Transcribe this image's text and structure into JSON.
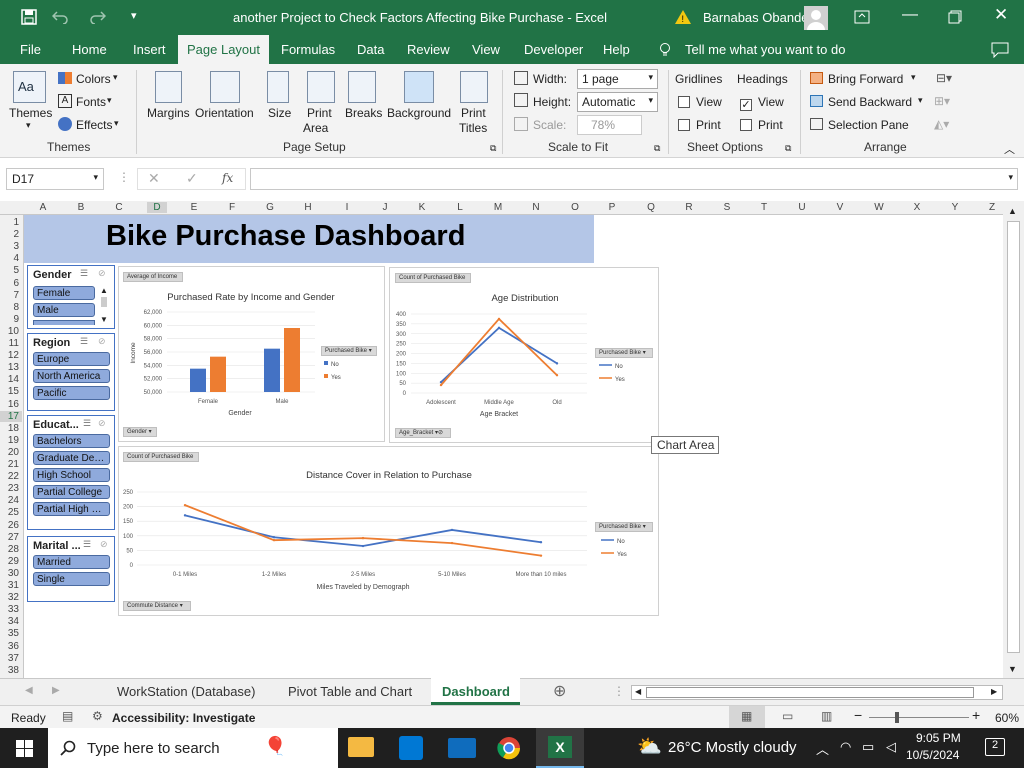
{
  "window": {
    "title": "another Project to Check Factors Affecting Bike Purchase  -  Excel",
    "user": "Barnabas Obande"
  },
  "menu": [
    "File",
    "Home",
    "Insert",
    "Page Layout",
    "Formulas",
    "Data",
    "Review",
    "View",
    "Developer",
    "Help"
  ],
  "tell_me": "Tell me what you want to do",
  "ribbon": {
    "themes": "Themes",
    "colors": "Colors",
    "fonts": "Fonts",
    "effects": "Effects",
    "margins": "Margins",
    "orientation": "Orientation",
    "size": "Size",
    "print_area": [
      "Print",
      "Area"
    ],
    "breaks": "Breaks",
    "background": "Background",
    "print_titles": [
      "Print",
      "Titles"
    ],
    "width_label": "Width:",
    "width_value": "1 page",
    "height_label": "Height:",
    "height_value": "Automatic",
    "scale_label": "Scale:",
    "scale_value": "78%",
    "gridlines": "Gridlines",
    "headings": "Headings",
    "view": "View",
    "print": "Print",
    "gridlines_view_checked": false,
    "headings_view_checked": true,
    "bring_forward": "Bring Forward",
    "send_backward": "Send Backward",
    "selection_pane": "Selection Pane",
    "groups": [
      "Themes",
      "Page Setup",
      "Scale to Fit",
      "Sheet Options",
      "Arrange"
    ]
  },
  "formula_bar": {
    "name_box": "D17",
    "fx": "fx",
    "formula": ""
  },
  "columns": [
    "A",
    "B",
    "C",
    "D",
    "E",
    "F",
    "G",
    "H",
    "I",
    "J",
    "K",
    "L",
    "M",
    "N",
    "O",
    "P",
    "Q",
    "R",
    "S",
    "T",
    "U",
    "V",
    "W",
    "X",
    "Y",
    "Z"
  ],
  "rows": [
    "1",
    "2",
    "3",
    "4",
    "5",
    "6",
    "7",
    "8",
    "9",
    "10",
    "11",
    "12",
    "13",
    "14",
    "15",
    "16",
    "17",
    "18",
    "19",
    "20",
    "21",
    "22",
    "23",
    "24",
    "25",
    "26",
    "27",
    "28",
    "29",
    "30",
    "31",
    "32",
    "33",
    "34",
    "35",
    "36",
    "37",
    "38"
  ],
  "dashboard": {
    "title": "Bike Purchase Dashboard",
    "slicers": {
      "gender": {
        "title": "Gender",
        "items": [
          "Female",
          "Male"
        ]
      },
      "region": {
        "title": "Region",
        "items": [
          "Europe",
          "North America",
          "Pacific"
        ]
      },
      "education": {
        "title": "Educat...",
        "items": [
          "Bachelors",
          "Graduate Deg...",
          "High School",
          "Partial College",
          "Partial High S..."
        ]
      },
      "marital": {
        "title": "Marital ...",
        "items": [
          "Married",
          "Single"
        ]
      }
    },
    "tooltip": "Chart Area"
  },
  "chart_data": [
    {
      "type": "bar",
      "title": "Purchased Rate by Income and Gender",
      "xlabel": "Gender",
      "ylabel": "Income",
      "field_button": "Average of Income",
      "axis_button": "Gender",
      "legend_title": "Purchased Bike",
      "legend_position": "right",
      "categories": [
        "Female",
        "Male"
      ],
      "ylim": [
        50000,
        62000
      ],
      "yticks": [
        "62,000",
        "60,000",
        "58,000",
        "56,000",
        "54,000",
        "52,000",
        "50,000"
      ],
      "series": [
        {
          "name": "No",
          "color": "#4472c4",
          "values": [
            53500,
            56500
          ]
        },
        {
          "name": "Yes",
          "color": "#ed7d31",
          "values": [
            55300,
            59600
          ]
        }
      ]
    },
    {
      "type": "line",
      "title": "Age Distribution",
      "xlabel": "Age Bracket",
      "field_button": "Count of Purchased Bike",
      "axis_button": "Age_Bracket",
      "legend_title": "Purchased Bike",
      "legend_position": "right",
      "categories": [
        "Adolescent",
        "Middle Age",
        "Old"
      ],
      "ylim": [
        0,
        400
      ],
      "yticks": [
        "400",
        "350",
        "300",
        "250",
        "200",
        "150",
        "100",
        "50",
        "0"
      ],
      "series": [
        {
          "name": "No",
          "color": "#4472c4",
          "values": [
            55,
            330,
            150
          ]
        },
        {
          "name": "Yes",
          "color": "#ed7d31",
          "values": [
            40,
            375,
            90
          ]
        }
      ]
    },
    {
      "type": "line",
      "title": "Distance Cover in Relation to Purchase",
      "xlabel": "Miles Traveled by Demograph",
      "field_button": "Count of Purchased Bike",
      "axis_button": "Commute Distance",
      "legend_title": "Purchased Bike",
      "legend_position": "right",
      "categories": [
        "0-1 Miles",
        "1-2 Miles",
        "2-5 Miles",
        "5-10 Miles",
        "More than 10 miles"
      ],
      "ylim": [
        0,
        250
      ],
      "yticks": [
        "250",
        "200",
        "150",
        "100",
        "50",
        "0"
      ],
      "series": [
        {
          "name": "No",
          "color": "#4472c4",
          "values": [
            170,
            95,
            65,
            120,
            78
          ]
        },
        {
          "name": "Yes",
          "color": "#ed7d31",
          "values": [
            205,
            85,
            92,
            75,
            32
          ]
        }
      ]
    }
  ],
  "sheet_tabs": [
    "WorkStation (Database)",
    "Pivot Table and Chart",
    "Dashboard"
  ],
  "active_tab": "Dashboard",
  "status": {
    "ready": "Ready",
    "accessibility": "Accessibility: Investigate",
    "zoom": "60%"
  },
  "taskbar": {
    "search": "Type here to search",
    "weather": "26°C  Mostly cloudy",
    "time": "9:05 PM",
    "date": "10/5/2024",
    "notifications": "2"
  }
}
